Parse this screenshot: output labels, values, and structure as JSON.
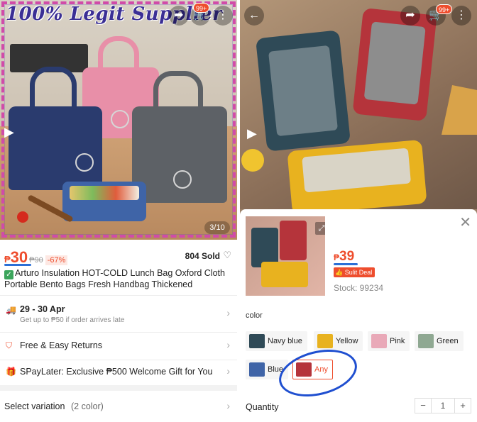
{
  "left": {
    "banner": "100% Legit Supplier",
    "cart_badge": "99+",
    "image_counter": "3/10",
    "price": {
      "currency": "₱",
      "current": "30",
      "original": "₱90",
      "discount": "-67%"
    },
    "sold": "804 Sold",
    "title": "Arturo Insulation HOT-COLD Lunch Bag Oxford Cloth Portable Bento Bags Fresh Handbag Thickened",
    "delivery": {
      "dates": "29 - 30 Apr",
      "note": "Get up to ₱50 if order arrives late"
    },
    "returns": "Free & Easy Returns",
    "spaylater": "SPayLater: Exclusive ₱500 Welcome Gift for You",
    "variation": {
      "label": "Select variation",
      "count": "(2 color)"
    }
  },
  "right": {
    "cart_badge": "99+",
    "sheet": {
      "currency": "₱",
      "price": "39",
      "deal_badge": "Sulit Deal",
      "stock": "Stock: 99234",
      "color_label": "color",
      "options": [
        {
          "label": "Navy blue",
          "swatch": "#2f4a57"
        },
        {
          "label": "Yellow",
          "swatch": "#e8b21f"
        },
        {
          "label": "Pink",
          "swatch": "#e9a9b8"
        },
        {
          "label": "Green",
          "swatch": "#8fa892"
        },
        {
          "label": "Blue",
          "swatch": "#3f64a7"
        },
        {
          "label": "Any",
          "swatch": "#b5343b"
        }
      ],
      "selected_option": "Any",
      "quantity_label": "Quantity",
      "quantity": "1"
    }
  },
  "colors": {
    "accent": "#ee4d2d",
    "annotation": "#1f4fd0"
  }
}
